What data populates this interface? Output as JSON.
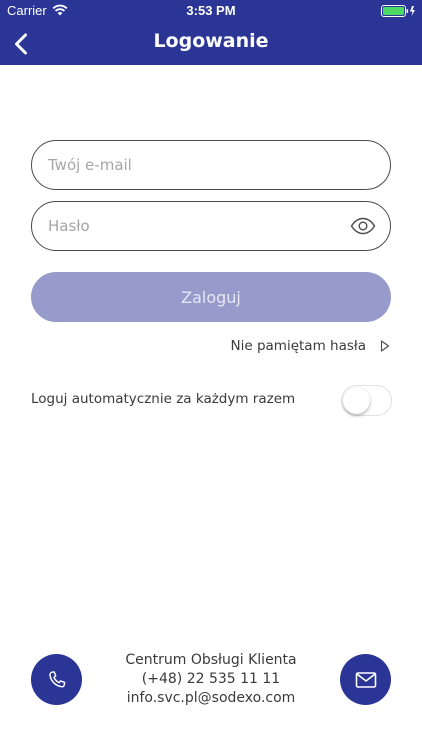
{
  "status_bar": {
    "carrier": "Carrier",
    "time": "3:53 PM"
  },
  "header": {
    "title": "Logowanie",
    "background_color": "#2a3596"
  },
  "form": {
    "email_placeholder": "Twój e-mail",
    "email_value": "",
    "password_placeholder": "Hasło",
    "password_value": "",
    "login_label": "Zaloguj",
    "login_button_color": "#969bcc",
    "forgot_password_label": "Nie pamiętam hasła",
    "auto_login_label": "Loguj automatycznie za każdym razem",
    "auto_login_enabled": false
  },
  "contact": {
    "title": "Centrum Obsługi Klienta",
    "phone": "(+48) 22 535 11 11",
    "email": "info.svc.pl@sodexo.com",
    "call_icon": "phone-icon",
    "mail_icon": "envelope-icon"
  }
}
